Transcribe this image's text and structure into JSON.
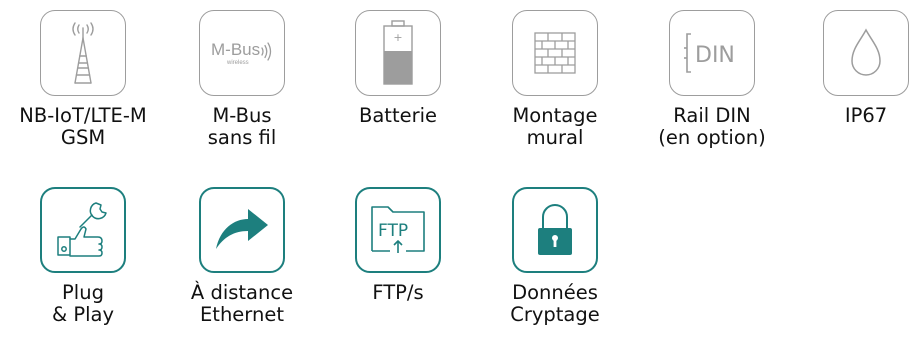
{
  "colors": {
    "gray_icon": "#9d9d9d",
    "teal_icon": "#1d7f7e",
    "text": "#111111"
  },
  "features": [
    {
      "id": "nb-iot",
      "icon": "antenna-tower-icon",
      "line1": "NB-IoT/LTE-M",
      "line2": "GSM"
    },
    {
      "id": "mbus",
      "icon": "mbus-wireless-icon",
      "icon_text": "M-Bus",
      "icon_subtext": "wireless",
      "line1": "M-Bus",
      "line2": "sans fil"
    },
    {
      "id": "battery",
      "icon": "battery-icon",
      "icon_text": "+",
      "line1": "Batterie",
      "line2": ""
    },
    {
      "id": "wall",
      "icon": "brick-wall-icon",
      "line1": "Montage",
      "line2": "mural"
    },
    {
      "id": "din",
      "icon": "din-rail-icon",
      "icon_text": "DIN",
      "line1": "Rail DIN",
      "line2": "(en option)"
    },
    {
      "id": "ip67",
      "icon": "water-drop-icon",
      "line1": "IP67",
      "line2": ""
    },
    {
      "id": "plug",
      "icon": "thumbs-up-wrench-icon",
      "line1": "Plug",
      "line2": "& Play"
    },
    {
      "id": "remote",
      "icon": "share-arrow-icon",
      "line1": "À distance",
      "line2": "Ethernet"
    },
    {
      "id": "ftp",
      "icon": "ftp-folder-icon",
      "icon_text": "FTP",
      "line1": "FTP/s",
      "line2": ""
    },
    {
      "id": "crypto",
      "icon": "padlock-icon",
      "line1": "Données",
      "line2": "Cryptage"
    }
  ]
}
